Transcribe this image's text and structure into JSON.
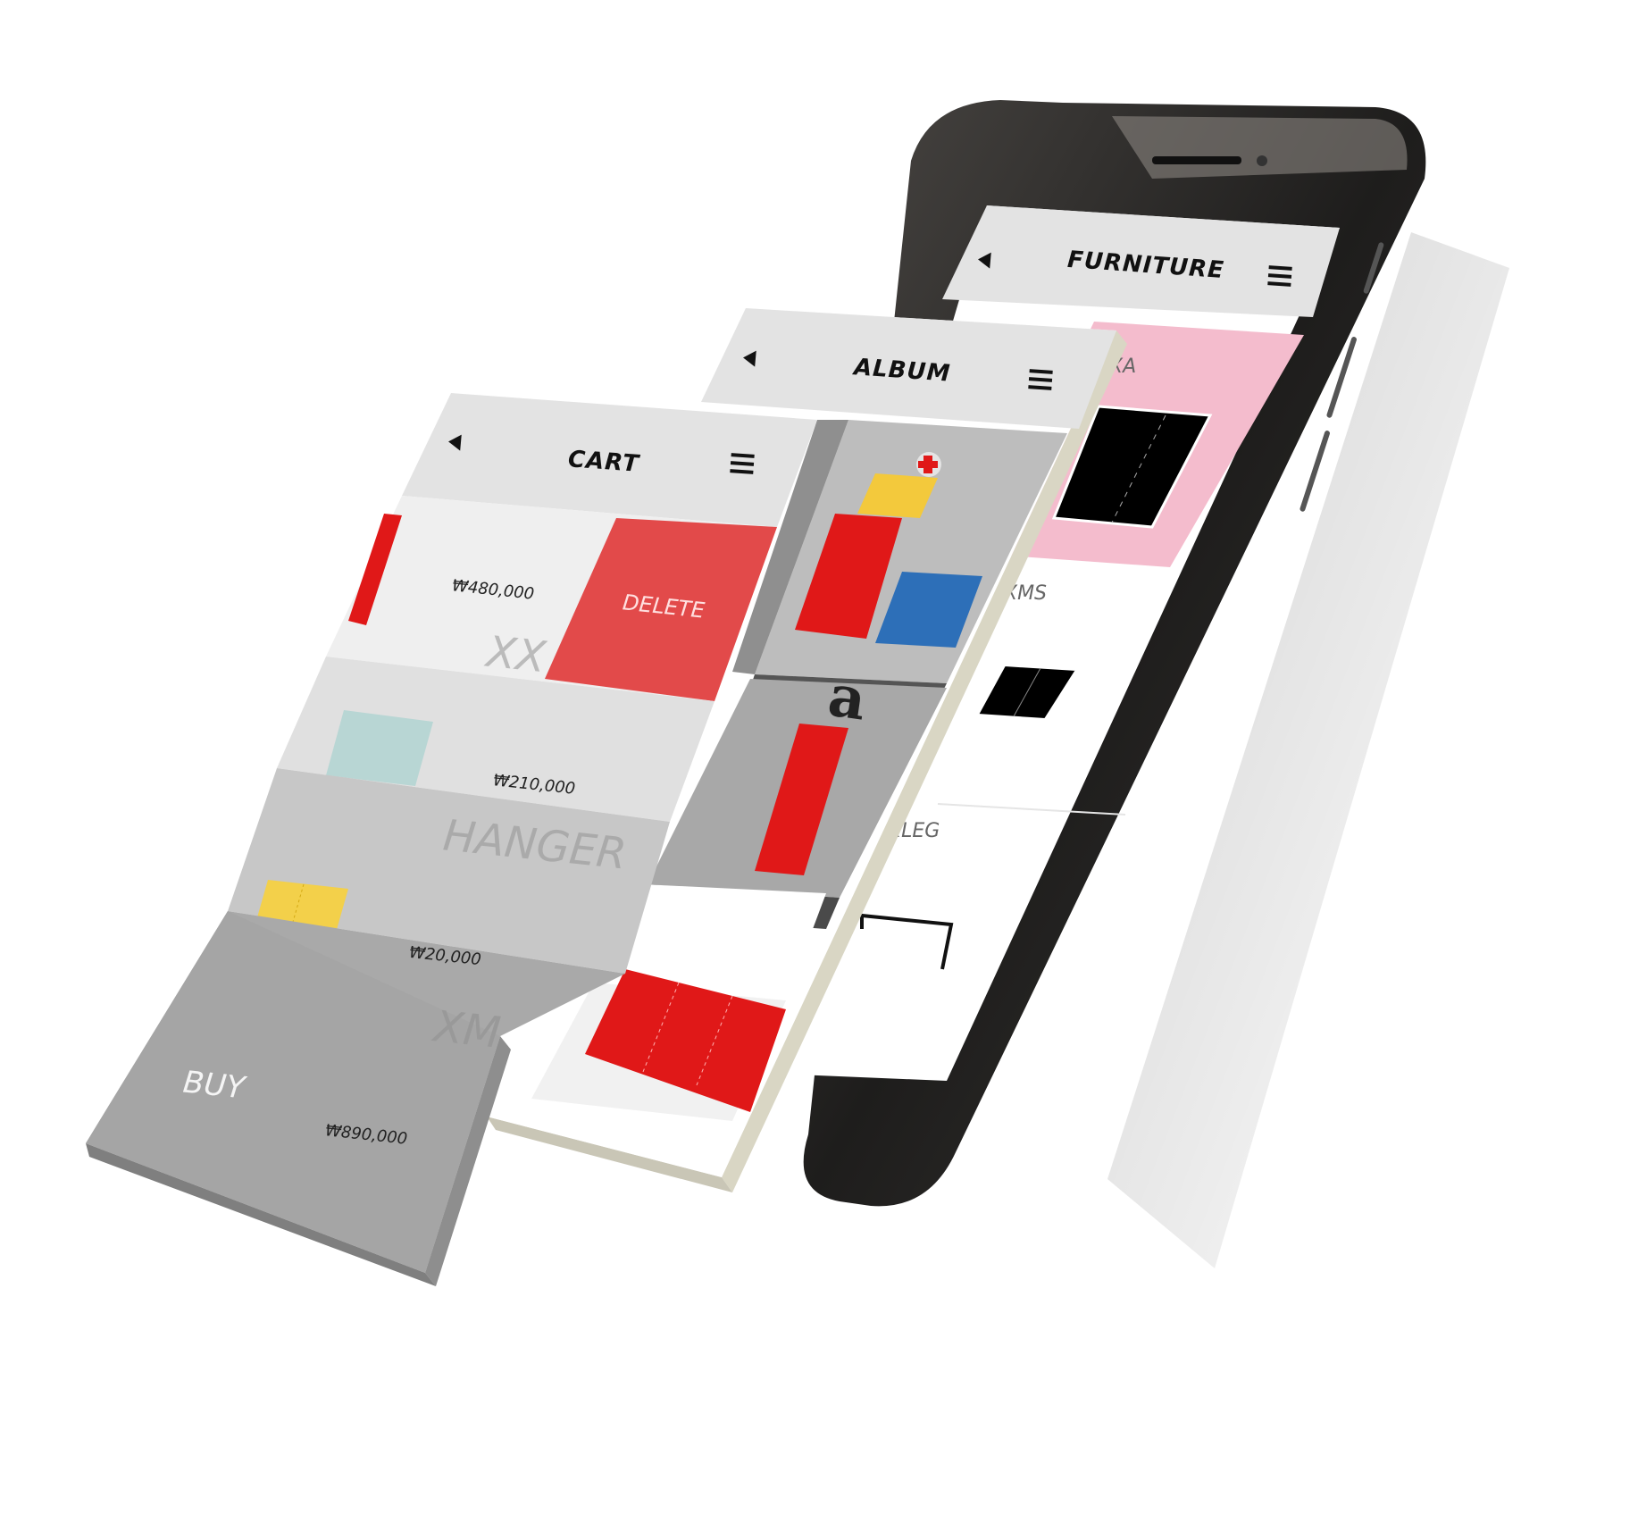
{
  "furniture_screen": {
    "title": "FURNITURE",
    "items": [
      {
        "label": "XA",
        "bg": "#f4bccd"
      },
      {
        "label": "XMS",
        "bg": "#ffffff"
      },
      {
        "label": "XLEG",
        "bg": "#ffffff"
      }
    ]
  },
  "album_screen": {
    "title": "ALBUM"
  },
  "cart_screen": {
    "title": "CART",
    "items": [
      {
        "name": "XX",
        "price": "₩480,000",
        "bg": "#efefef",
        "thumb_color": "#e02020"
      },
      {
        "name": "HANGER",
        "price": "₩210,000",
        "bg": "#e0e0e0",
        "thumb_color": "#b8d6d4"
      },
      {
        "name": "XM",
        "price": "₩20,000",
        "bg": "#c7c7c7",
        "thumb_color": "#f3d04a"
      }
    ],
    "delete_label": "DELETE",
    "delete_color": "#e24a4a",
    "buy_label": "BUY",
    "total": "₩890,000",
    "footer_bg": "#a9a9a9"
  },
  "colors": {
    "phone_body": "#2c2a28",
    "screen_bar": "#e3e3e3",
    "accent_red": "#e02020",
    "pink": "#f4bccd"
  }
}
